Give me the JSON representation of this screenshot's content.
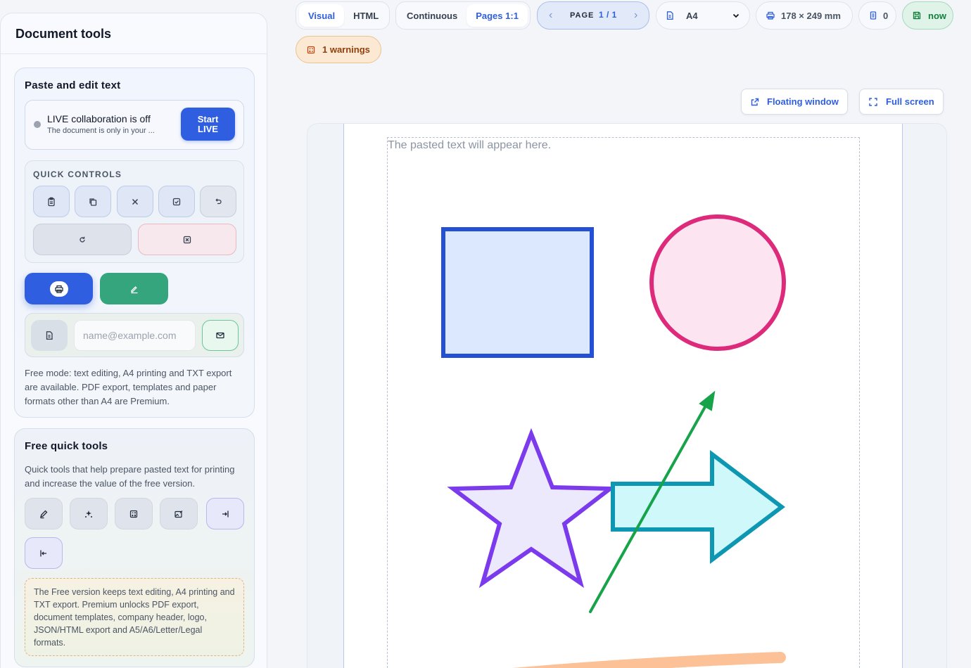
{
  "sidebar": {
    "title": "Document tools",
    "paste_panel": {
      "title": "Paste and edit text",
      "live": {
        "title": "LIVE collaboration is off",
        "subtitle": "The document is only in your ...",
        "button_line1": "Start",
        "button_line2": "LIVE"
      },
      "quick_controls_label": "QUICK CONTROLS",
      "email_placeholder": "name@example.com",
      "note": "Free mode: text editing, A4 printing and TXT export are available. PDF export, templates and paper formats other than A4 are Premium."
    },
    "free_tools_panel": {
      "title": "Free quick tools",
      "description": "Quick tools that help prepare pasted text for printing and increase the value of the free version.",
      "premium_note": "The Free version keeps text editing, A4 printing and TXT export. Premium unlocks PDF export, document templates, company header, logo, JSON/HTML export and A5/A6/Letter/Legal formats."
    }
  },
  "toolbar": {
    "view_tabs": [
      "Visual",
      "HTML"
    ],
    "layout_tabs": [
      "Continuous",
      "Pages 1:1"
    ],
    "pager": {
      "prev": "‹",
      "label": "PAGE",
      "current": "1 / 1",
      "next": "›"
    },
    "paper_format": "A4",
    "print_size": "178 × 249 mm",
    "page_count": "0",
    "save_status": "now",
    "warnings": "1 warnings",
    "floating_window": "Floating window",
    "full_screen": "Full screen"
  },
  "preview": {
    "placeholder": "The pasted text will appear here."
  },
  "colors": {
    "accent": "#2f5fe0",
    "success": "#34a57c",
    "warning": "#92400e",
    "square": "#2450d6",
    "circle": "#dd2a7b",
    "star": "#7c3aed",
    "arrow_shape": "#0e97b2",
    "arrow_line": "#16a34a",
    "brush": "#fdba8c"
  }
}
